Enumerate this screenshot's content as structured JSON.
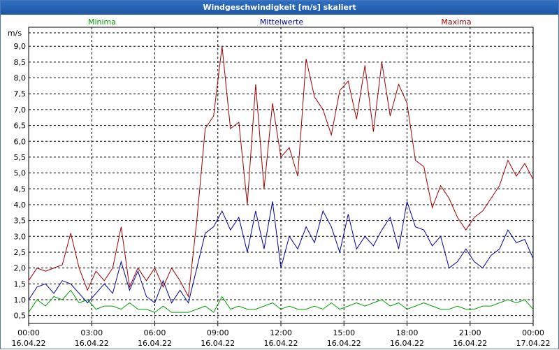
{
  "window": {
    "title": "Windgeschwindigkeit [m/s] skaliert"
  },
  "chart_data": {
    "type": "line",
    "title": "Windgeschwindigkeit [m/s] skaliert",
    "ylabel": "m/s",
    "xlabel": "",
    "ylim": [
      0.25,
      9.6
    ],
    "xlim": [
      0,
      24
    ],
    "y_ticks": [
      "0,5",
      "1,0",
      "1,5",
      "2,0",
      "2,5",
      "3,0",
      "3,5",
      "4,0",
      "4,5",
      "5,0",
      "5,5",
      "6,0",
      "6,5",
      "7,0",
      "7,5",
      "8,0",
      "8,5",
      "9,0"
    ],
    "y_tick_values": [
      0.5,
      1.0,
      1.5,
      2.0,
      2.5,
      3.0,
      3.5,
      4.0,
      4.5,
      5.0,
      5.5,
      6.0,
      6.5,
      7.0,
      7.5,
      8.0,
      8.5,
      9.0
    ],
    "x_ticks": [
      {
        "time": "00:00",
        "date": "16.04.22",
        "hour": 0
      },
      {
        "time": "03:00",
        "date": "16.04.22",
        "hour": 3
      },
      {
        "time": "06:00",
        "date": "16.04.22",
        "hour": 6
      },
      {
        "time": "09:00",
        "date": "16.04.22",
        "hour": 9
      },
      {
        "time": "12:00",
        "date": "16.04.22",
        "hour": 12
      },
      {
        "time": "15:00",
        "date": "16.04.22",
        "hour": 15
      },
      {
        "time": "18:00",
        "date": "16.04.22",
        "hour": 18
      },
      {
        "time": "21:00",
        "date": "16.04.22",
        "hour": 21
      },
      {
        "time": "00:00",
        "date": "17.04.22",
        "hour": 24
      }
    ],
    "grid": true,
    "legend_position": "top",
    "series": [
      {
        "name": "Minima",
        "color": "#00a000",
        "x": [
          0,
          0.4,
          0.8,
          1.2,
          1.6,
          2.0,
          2.4,
          2.8,
          3.2,
          3.6,
          4.0,
          4.4,
          4.8,
          5.2,
          5.6,
          6.0,
          6.4,
          6.8,
          7.2,
          7.6,
          8.0,
          8.4,
          8.8,
          9.2,
          9.6,
          10.0,
          10.4,
          10.8,
          11.2,
          11.6,
          12.0,
          12.4,
          12.8,
          13.2,
          13.6,
          14.0,
          14.4,
          14.8,
          15.2,
          15.6,
          16.0,
          16.4,
          16.8,
          17.2,
          17.6,
          18.0,
          18.4,
          18.8,
          19.2,
          19.6,
          20.0,
          20.4,
          20.8,
          21.2,
          21.6,
          22.0,
          22.4,
          22.8,
          23.2,
          23.6,
          24.0
        ],
        "values": [
          0.6,
          1.0,
          0.8,
          1.1,
          1.0,
          1.3,
          0.9,
          1.0,
          0.7,
          0.8,
          0.8,
          0.7,
          0.9,
          0.7,
          0.7,
          0.6,
          0.8,
          0.6,
          0.6,
          0.6,
          0.7,
          0.8,
          0.6,
          1.1,
          0.7,
          0.8,
          0.7,
          0.7,
          0.8,
          0.9,
          0.7,
          0.8,
          0.7,
          0.7,
          0.8,
          0.7,
          0.9,
          0.7,
          0.8,
          0.9,
          0.8,
          0.9,
          1.0,
          0.8,
          0.9,
          0.7,
          0.8,
          0.9,
          0.8,
          0.7,
          0.7,
          0.8,
          0.7,
          0.7,
          0.8,
          0.8,
          0.9,
          1.0,
          0.9,
          1.0,
          0.7
        ]
      },
      {
        "name": "Mittelwerte",
        "color": "#0000a0",
        "x": [
          0,
          0.4,
          0.8,
          1.2,
          1.6,
          2.0,
          2.4,
          2.8,
          3.2,
          3.6,
          4.0,
          4.4,
          4.8,
          5.2,
          5.6,
          6.0,
          6.4,
          6.8,
          7.2,
          7.6,
          8.0,
          8.4,
          8.8,
          9.2,
          9.6,
          10.0,
          10.4,
          10.8,
          11.2,
          11.6,
          12.0,
          12.4,
          12.8,
          13.2,
          13.6,
          14.0,
          14.4,
          14.8,
          15.2,
          15.6,
          16.0,
          16.4,
          16.8,
          17.2,
          17.6,
          18.0,
          18.4,
          18.8,
          19.2,
          19.6,
          20.0,
          20.4,
          20.8,
          21.2,
          21.6,
          22.0,
          22.4,
          22.8,
          23.2,
          23.6,
          24.0
        ],
        "values": [
          1.0,
          1.4,
          1.5,
          1.2,
          1.6,
          1.5,
          1.2,
          0.9,
          1.2,
          1.5,
          1.2,
          2.2,
          1.3,
          1.9,
          1.1,
          0.9,
          1.6,
          0.9,
          1.3,
          0.9,
          2.0,
          3.1,
          3.3,
          3.8,
          3.2,
          3.6,
          2.5,
          3.8,
          2.6,
          4.1,
          2.0,
          3.0,
          2.6,
          3.3,
          2.8,
          3.8,
          3.3,
          2.5,
          3.7,
          2.6,
          3.0,
          2.7,
          3.2,
          3.6,
          2.6,
          4.1,
          3.3,
          3.2,
          2.7,
          3.0,
          2.0,
          2.2,
          2.6,
          2.2,
          2.0,
          2.4,
          2.6,
          3.2,
          2.8,
          2.9,
          2.3
        ]
      },
      {
        "name": "Maxima",
        "color": "#a00000",
        "x": [
          0,
          0.4,
          0.8,
          1.2,
          1.6,
          2.0,
          2.4,
          2.8,
          3.2,
          3.6,
          4.0,
          4.4,
          4.8,
          5.2,
          5.6,
          6.0,
          6.4,
          6.8,
          7.2,
          7.6,
          8.0,
          8.4,
          8.8,
          9.2,
          9.6,
          10.0,
          10.4,
          10.8,
          11.2,
          11.6,
          12.0,
          12.4,
          12.8,
          13.2,
          13.6,
          14.0,
          14.4,
          14.8,
          15.2,
          15.6,
          16.0,
          16.4,
          16.8,
          17.2,
          17.6,
          18.0,
          18.4,
          18.8,
          19.2,
          19.6,
          20.0,
          20.4,
          20.8,
          21.2,
          21.6,
          22.0,
          22.4,
          22.8,
          23.2,
          23.6,
          24.0
        ],
        "values": [
          1.6,
          2.0,
          1.9,
          2.0,
          2.1,
          3.1,
          2.0,
          1.3,
          1.9,
          1.6,
          2.0,
          3.3,
          1.4,
          2.0,
          1.6,
          2.0,
          1.4,
          2.0,
          1.6,
          1.1,
          3.5,
          6.4,
          6.8,
          9.0,
          6.4,
          6.6,
          4.0,
          7.8,
          4.5,
          7.2,
          5.5,
          5.8,
          4.9,
          8.6,
          7.4,
          7.0,
          6.2,
          7.6,
          7.9,
          6.7,
          8.4,
          6.3,
          8.5,
          6.8,
          7.8,
          7.2,
          5.4,
          5.2,
          3.9,
          4.6,
          4.2,
          3.6,
          3.2,
          3.6,
          3.8,
          4.2,
          4.6,
          5.4,
          4.9,
          5.3,
          4.8
        ]
      }
    ]
  }
}
